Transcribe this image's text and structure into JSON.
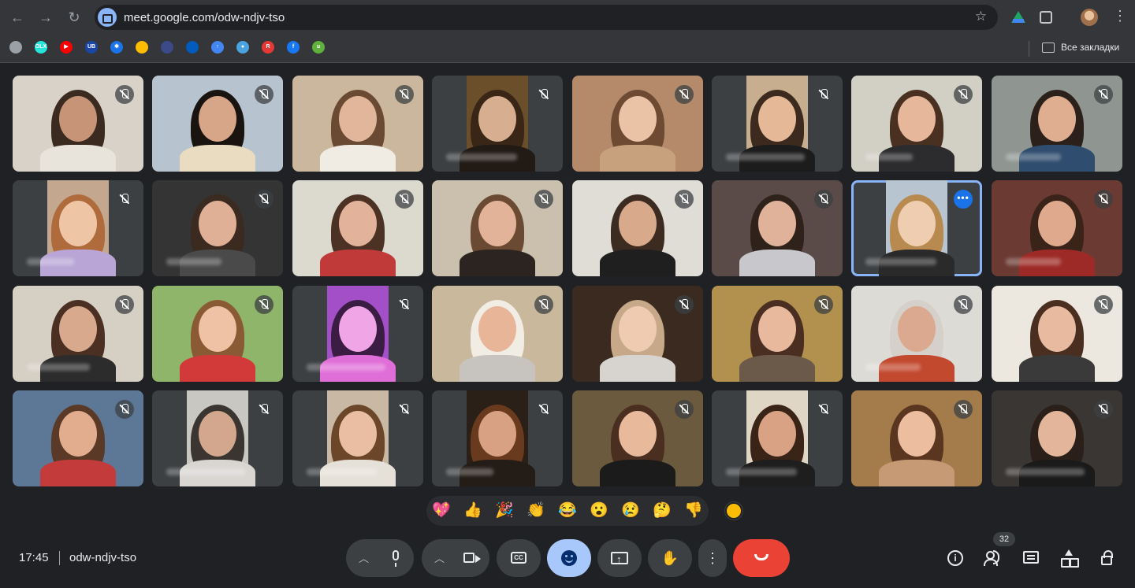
{
  "browser": {
    "url": "meet.google.com/odw-ndjv-tso",
    "bookmarks": [
      {
        "icon": "globe-icon",
        "color": "#9aa0a6",
        "label": ""
      },
      {
        "icon": "olx-icon",
        "color": "#23e5db",
        "label": "OLX"
      },
      {
        "icon": "youtube-icon",
        "color": "#ff0000",
        "label": "▶"
      },
      {
        "icon": "ub-icon",
        "color": "#1a47a6",
        "label": "UB"
      },
      {
        "icon": "star-icon",
        "color": "#1a73e8",
        "label": "✱"
      },
      {
        "icon": "lifecell-icon",
        "color": "#fbbc04",
        "label": ""
      },
      {
        "icon": "planet-icon",
        "color": "#3c4a8a",
        "label": ""
      },
      {
        "icon": "trident-icon",
        "color": "#005bbb",
        "label": ""
      },
      {
        "icon": "arrow-icon",
        "color": "#4285f4",
        "label": "↑"
      },
      {
        "icon": "record-icon",
        "color": "#4aa3df",
        "label": "●"
      },
      {
        "icon": "r-icon",
        "color": "#e53935",
        "label": "R"
      },
      {
        "icon": "facebook-icon",
        "color": "#1877f2",
        "label": "f"
      },
      {
        "icon": "green-u-icon",
        "color": "#5fb13e",
        "label": "u"
      }
    ],
    "all_bookmarks_label": "Все закладки"
  },
  "tiles": [
    {
      "bg": "#d9d2c8",
      "skin": "#c79477",
      "hair": "#3a2a20",
      "shirt": "#e8e4dc",
      "video_width": 1.0,
      "blur_w": 0
    },
    {
      "bg": "#b7c4cf",
      "skin": "#d7a587",
      "hair": "#1a1411",
      "shirt": "#e9dcc0",
      "video_width": 1.0,
      "blur_w": 0
    },
    {
      "bg": "#cbb79d",
      "skin": "#e2b69a",
      "hair": "#6b4a33",
      "shirt": "#f0ece3",
      "video_width": 1.0,
      "blur_w": 0
    },
    {
      "bg": "#6b4e2a",
      "skin": "#d7ae90",
      "hair": "#3a2616",
      "shirt": "#221a15",
      "video_width": 0.47,
      "blur_w": 90
    },
    {
      "bg": "#b48a6a",
      "skin": "#eac2a5",
      "hair": "#6d4a31",
      "shirt": "#c7a17d",
      "video_width": 1.0,
      "blur_w": 0
    },
    {
      "bg": "#c7ae8e",
      "skin": "#e5b898",
      "hair": "#3c2a1f",
      "shirt": "#1c1c1c",
      "video_width": 0.47,
      "blur_w": 100
    },
    {
      "bg": "#d2cfc5",
      "skin": "#e6b79a",
      "hair": "#4a3020",
      "shirt": "#2c2c2e",
      "video_width": 1.0,
      "blur_w": 60
    },
    {
      "bg": "#8f9691",
      "skin": "#dfae91",
      "hair": "#2b211a",
      "shirt": "#2f4d6e",
      "video_width": 1.0,
      "blur_w": 70
    },
    {
      "bg": "#c4a78f",
      "skin": "#eec6a6",
      "hair": "#b06b3c",
      "shirt": "#b9a6d6",
      "video_width": 0.47,
      "blur_w": 60
    },
    {
      "bg": "#343434",
      "skin": "#dfb095",
      "hair": "#3a2a20",
      "shirt": "#4a4a4a",
      "video_width": 1.0,
      "blur_w": 70
    },
    {
      "bg": "#dcd9cf",
      "skin": "#e2b39a",
      "hair": "#4b3225",
      "shirt": "#c13a3a",
      "video_width": 1.0,
      "blur_w": 0
    },
    {
      "bg": "#cbbfae",
      "skin": "#e2b398",
      "hair": "#6a4a32",
      "shirt": "#2b2420",
      "video_width": 1.0,
      "blur_w": 0
    },
    {
      "bg": "#e0dcd6",
      "skin": "#d9a98c",
      "hair": "#3c2b20",
      "shirt": "#1f1f1f",
      "video_width": 1.0,
      "blur_w": 0
    },
    {
      "bg": "#5a4b48",
      "skin": "#e0b29a",
      "hair": "#2f221b",
      "shirt": "#c8c8cc",
      "video_width": 1.0,
      "blur_w": 0
    },
    {
      "bg": "#b8c4d0",
      "skin": "#efcdb1",
      "hair": "#b88a4f",
      "shirt": "#2a2a2a",
      "video_width": 0.47,
      "blur_w": 90
    },
    {
      "bg": "#6b3a33",
      "skin": "#dfa98e",
      "hair": "#3a241a",
      "shirt": "#9d2a26",
      "video_width": 1.0,
      "blur_w": 70
    },
    {
      "bg": "#d5cfc4",
      "skin": "#d8a98d",
      "hair": "#4a2f22",
      "shirt": "#2c2c2c",
      "video_width": 1.0,
      "blur_w": 80
    },
    {
      "bg": "#8fb56a",
      "skin": "#efc2a5",
      "hair": "#8a5a35",
      "shirt": "#d23a3a",
      "video_width": 1.0,
      "blur_w": 0
    },
    {
      "bg": "#a34fc8",
      "skin": "#f0a6e6",
      "hair": "#3b1d44",
      "shirt": "#e06ed8",
      "video_width": 0.47,
      "blur_w": 100
    },
    {
      "bg": "#c9b89b",
      "skin": "#e8b598",
      "hair": "#f1ede4",
      "shirt": "#c7c4c0",
      "video_width": 1.0,
      "blur_w": 0
    },
    {
      "bg": "#3a2a20",
      "skin": "#efcbb2",
      "hair": "#c7a98a",
      "shirt": "#d7d4cf",
      "video_width": 1.0,
      "blur_w": 0
    },
    {
      "bg": "#b2904e",
      "skin": "#e8b99d",
      "hair": "#4b2e22",
      "shirt": "#6b5a4a",
      "video_width": 1.0,
      "blur_w": 0
    },
    {
      "bg": "#dddbd5",
      "skin": "#dba98f",
      "hair": "#d5d0c9",
      "shirt": "#c2482e",
      "video_width": 1.0,
      "blur_w": 70
    },
    {
      "bg": "#ece8df",
      "skin": "#e8ba9f",
      "hair": "#4a2f21",
      "shirt": "#3a3a3a",
      "video_width": 1.0,
      "blur_w": 0
    },
    {
      "bg": "#5d7896",
      "skin": "#e2ad8f",
      "hair": "#5a3a26",
      "shirt": "#c33b3b",
      "video_width": 1.0,
      "blur_w": 0
    },
    {
      "bg": "#c9c7c2",
      "skin": "#d3a78e",
      "hair": "#3a3530",
      "shirt": "#d9d6d2",
      "video_width": 0.47,
      "blur_w": 100
    },
    {
      "bg": "#c9b9a4",
      "skin": "#e9bea3",
      "hair": "#6b4628",
      "shirt": "#e6e1d8",
      "video_width": 0.47,
      "blur_w": 90
    },
    {
      "bg": "#2b2017",
      "skin": "#d9a184",
      "hair": "#6a3a1e",
      "shirt": "#241c16",
      "video_width": 0.47,
      "blur_w": 60
    },
    {
      "bg": "#6b5a3e",
      "skin": "#e9b99c",
      "hair": "#4a2f20",
      "shirt": "#1b1b1b",
      "video_width": 1.0,
      "blur_w": 0
    },
    {
      "bg": "#e0d6c6",
      "skin": "#d9a285",
      "hair": "#3a2418",
      "shirt": "#1e1e1e",
      "video_width": 0.47,
      "blur_w": 90
    },
    {
      "bg": "#a47c4c",
      "skin": "#edbd9f",
      "hair": "#5a3520",
      "shirt": "#c59a74",
      "video_width": 1.0,
      "blur_w": 0
    },
    {
      "bg": "#3a3634",
      "skin": "#e3b69c",
      "hair": "#2a1f19",
      "shirt": "#1a1a1a",
      "video_width": 1.0,
      "blur_w": 100
    }
  ],
  "active_tile_index": 14,
  "reactions": [
    "💖",
    "👍",
    "🎉",
    "👏",
    "😂",
    "😮",
    "😢",
    "🤔",
    "👎"
  ],
  "bottom": {
    "time": "17:45",
    "meeting_code": "odw-ndjv-tso",
    "participant_count": "32",
    "cc_label": "CC"
  }
}
